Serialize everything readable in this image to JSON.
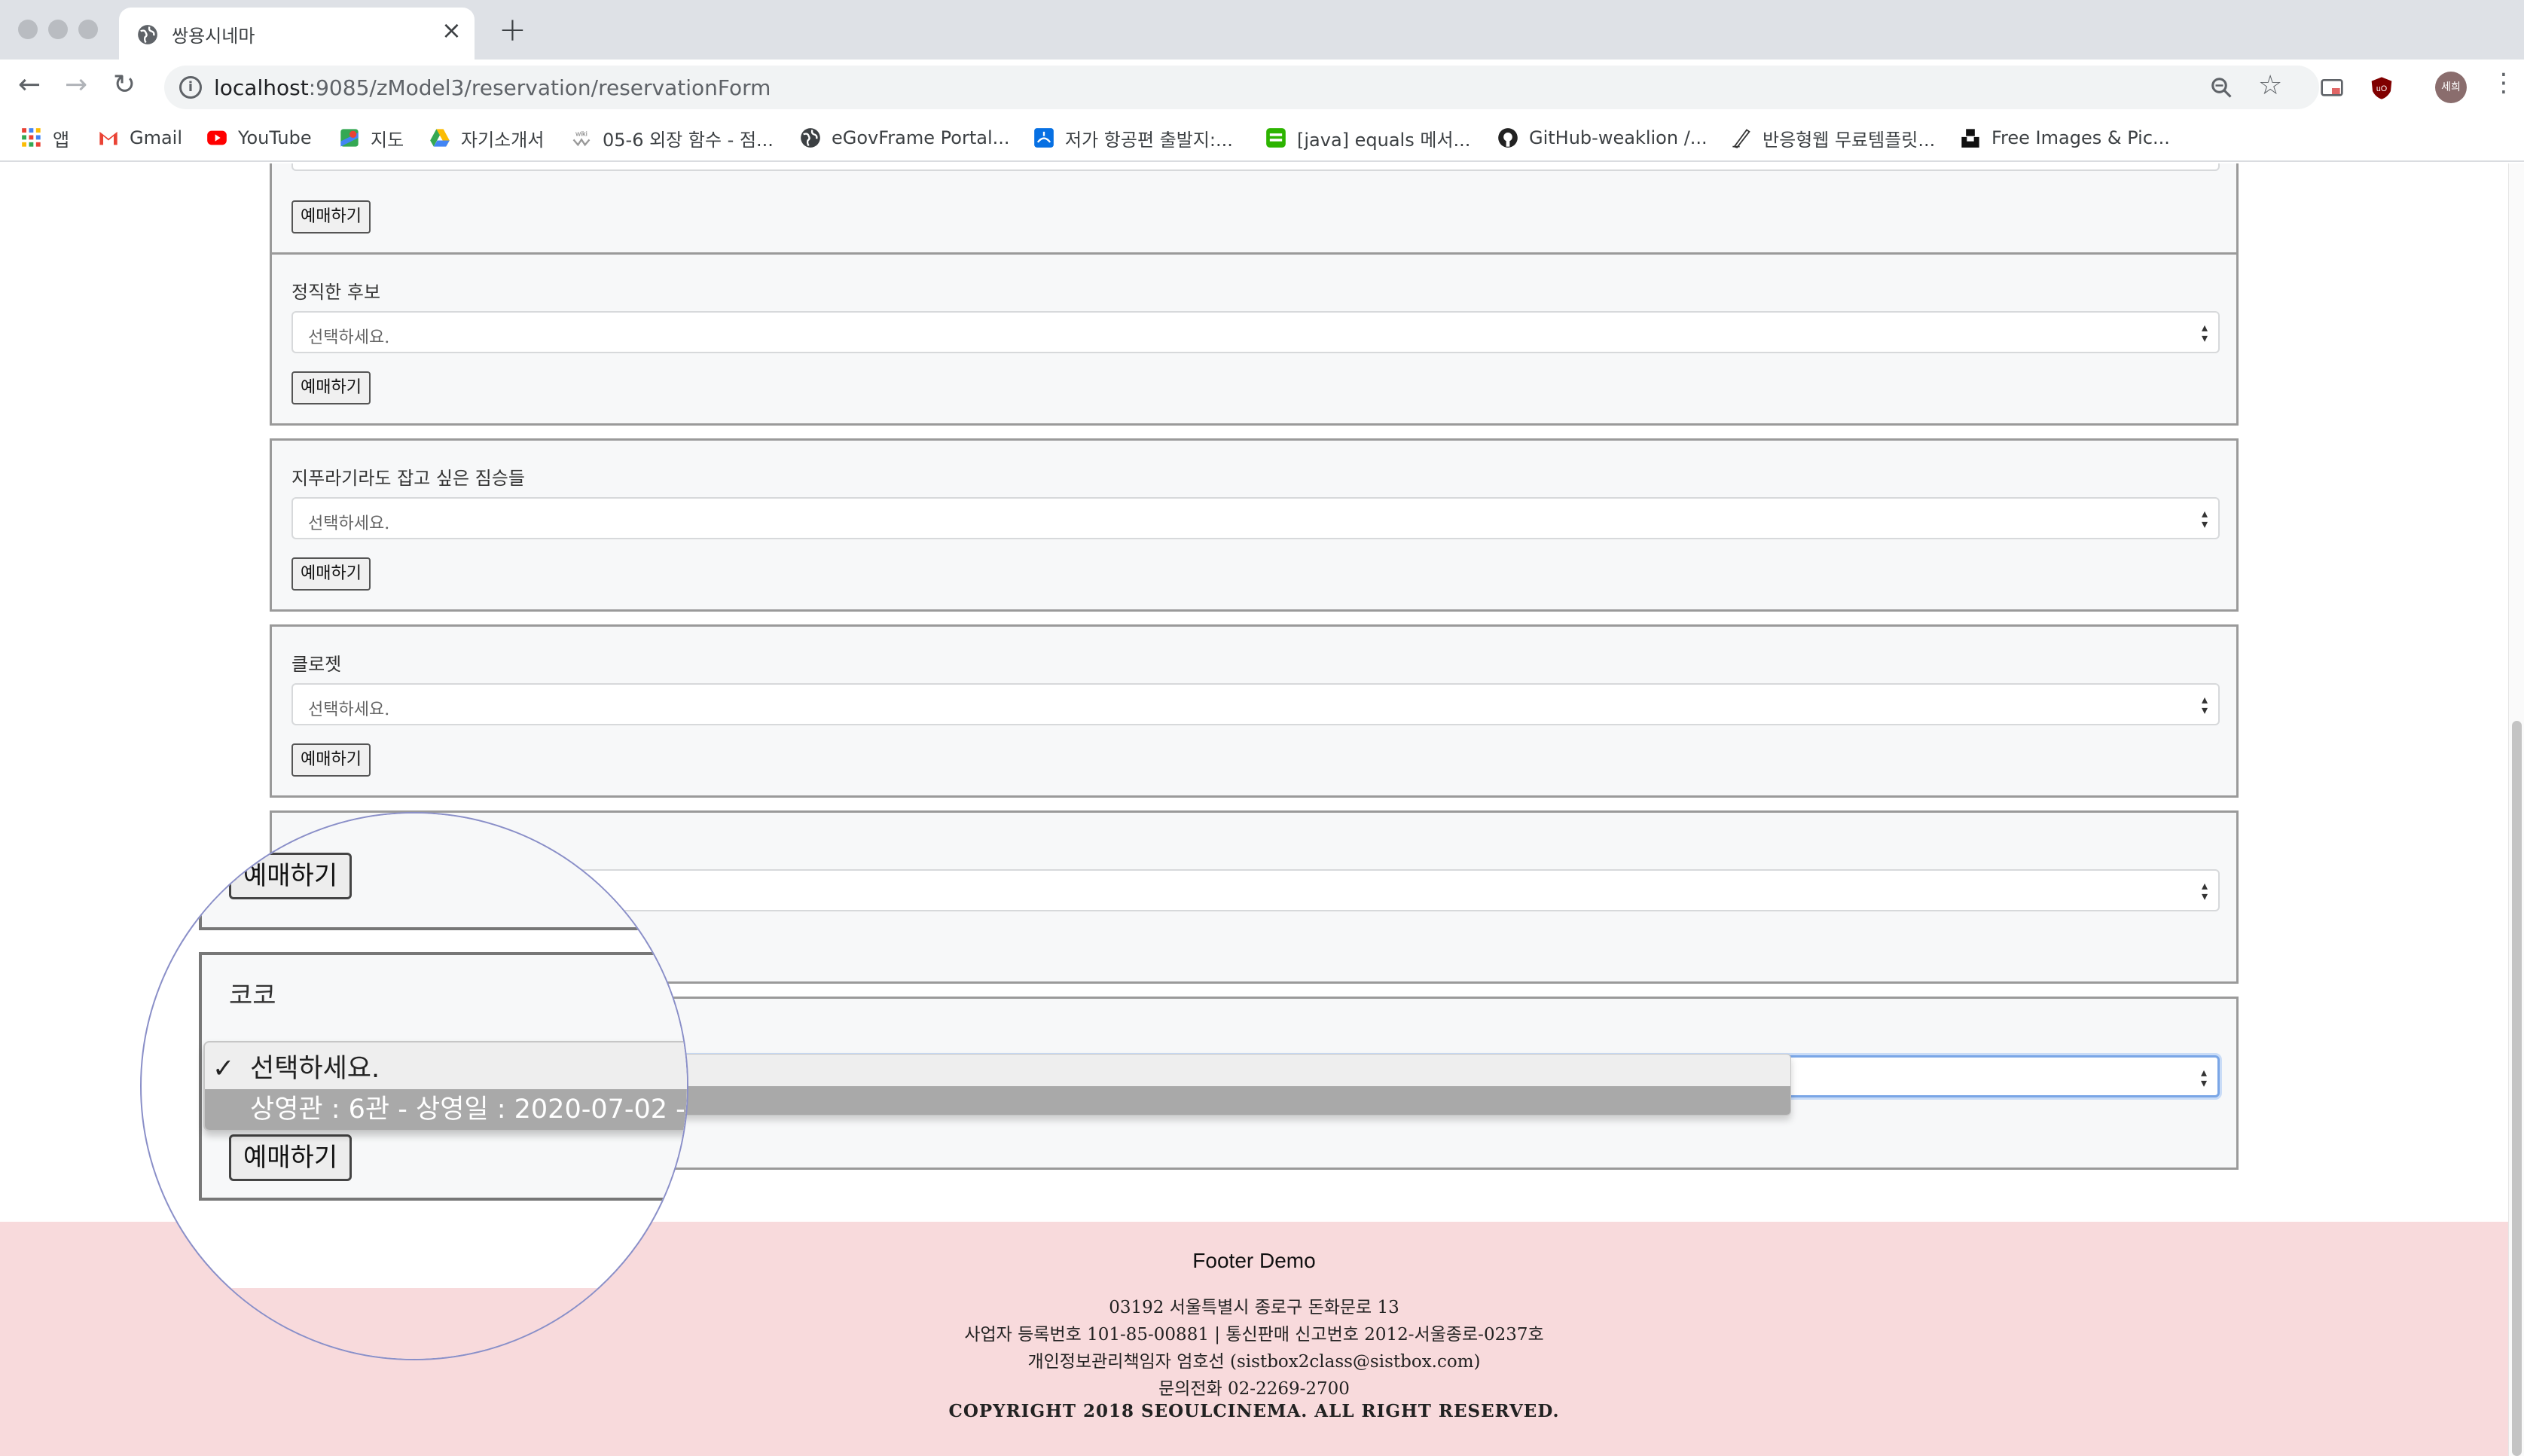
{
  "browser": {
    "tab_title": "쌍용시네마",
    "url_host": "localhost",
    "url_path": ":9085/zModel3/reservation/reservationForm",
    "avatar_text": "세희",
    "bookmarks": [
      "앱",
      "Gmail",
      "YouTube",
      "지도",
      "자기소개서",
      "05-6 외장 함수 - 점...",
      "eGovFrame Portal...",
      "저가 항공편 출발지:...",
      "[java] equals 메서...",
      "GitHub-weaklion /...",
      "반응형웹 무료템플릿...",
      "Free Images & Pic..."
    ]
  },
  "cards": [
    {
      "title": "",
      "button": "예매하기"
    },
    {
      "title": "정직한 후보",
      "placeholder": "선택하세요.",
      "button": "예매하기"
    },
    {
      "title": "지푸라기라도 잡고 싶은 짐승들",
      "placeholder": "선택하세요.",
      "button": "예매하기"
    },
    {
      "title": "클로젯",
      "placeholder": "선택하세요.",
      "button": "예매하기"
    },
    {
      "title": "",
      "placeholder": "",
      "button": ""
    },
    {
      "title": "코코",
      "placeholder": "",
      "button": "예매하기"
    }
  ],
  "dropdown": {
    "selected_option": "선택하세요.",
    "highlighted_option": "상영관 : 6관 - 상영일 : 2020-07-02 -",
    "check": "✓"
  },
  "footer": {
    "title": "Footer Demo",
    "address": "03192 서울특별시 종로구 돈화문로 13",
    "business": "사업자 등록번호 101-85-00881 | 통신판매 신고번호 2012-서울종로-0237호",
    "privacy": "개인정보관리책임자 엄호선 (sistbox2class@sistbox.com)",
    "phone": "문의전화 02-2269-2700",
    "copyright": "COPYRIGHT 2018 SEOULCINEMA. ALL RIGHT RESERVED."
  },
  "colors": {
    "footer_bg": "#f8dadc",
    "focus_ring": "#7aa6e6",
    "highlight_option": "#a9a9a9"
  }
}
